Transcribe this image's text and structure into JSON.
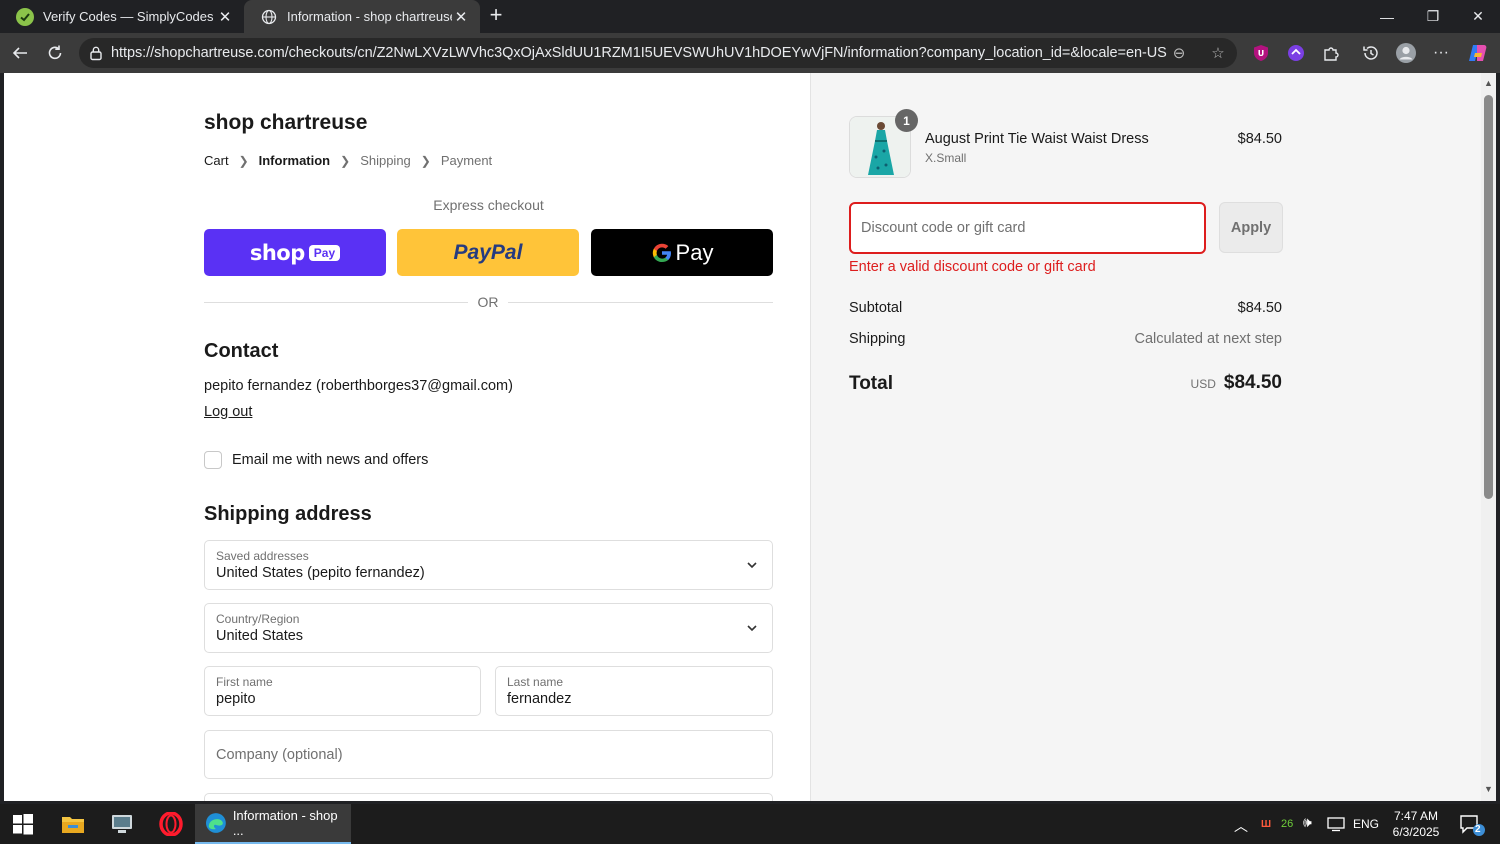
{
  "browser": {
    "tabs": [
      {
        "title": "Verify Codes — SimplyCodes",
        "active": false
      },
      {
        "title": "Information - shop chartreuse - C",
        "active": true
      }
    ],
    "url": "https://shopchartreuse.com/checkouts/cn/Z2NwLXVzLWVhc3QxOjAxSldUU1RZM1I5UEVSWUhUV1hDOEYwVjFN/information?company_location_id=&locale=en-US"
  },
  "checkout": {
    "shop_name": "shop chartreuse",
    "breadcrumb": [
      "Cart",
      "Information",
      "Shipping",
      "Payment"
    ],
    "express_label": "Express checkout",
    "express_buttons": {
      "shoppay": "shop",
      "shoppay_badge": "Pay",
      "paypal": "PayPal",
      "gpay": "Pay"
    },
    "or_text": "OR",
    "contact": {
      "heading": "Contact",
      "info": "pepito fernandez (roberthborges37@gmail.com)",
      "logout": "Log out",
      "newsletter_label": "Email me with news and offers",
      "newsletter_checked": false
    },
    "shipping": {
      "heading": "Shipping address",
      "saved_addresses_label": "Saved addresses",
      "saved_addresses_value": "United States (pepito fernandez)",
      "country_label": "Country/Region",
      "country_value": "United States",
      "first_name_label": "First name",
      "first_name_value": "pepito",
      "last_name_label": "Last name",
      "last_name_value": "fernandez",
      "company_placeholder": "Company (optional)"
    }
  },
  "summary": {
    "item": {
      "quantity": "1",
      "name": "August Print Tie Waist Waist Dress",
      "variant": "X.Small",
      "price": "$84.50"
    },
    "discount_placeholder": "Discount code or gift card",
    "apply_label": "Apply",
    "discount_error": "Enter a valid discount code or gift card",
    "subtotal_label": "Subtotal",
    "subtotal_value": "$84.50",
    "shipping_label": "Shipping",
    "shipping_value": "Calculated at next step",
    "total_label": "Total",
    "total_currency": "USD",
    "total_value": "$84.50"
  },
  "taskbar": {
    "active_app": "Information - shop ...",
    "tray_count": "26",
    "language": "ENG",
    "time": "7:47 AM",
    "date": "6/3/2025",
    "notifications": "2"
  },
  "colors": {
    "shoppay": "#5a31f4",
    "paypal": "#ffc439",
    "error": "#dd1d1d"
  }
}
